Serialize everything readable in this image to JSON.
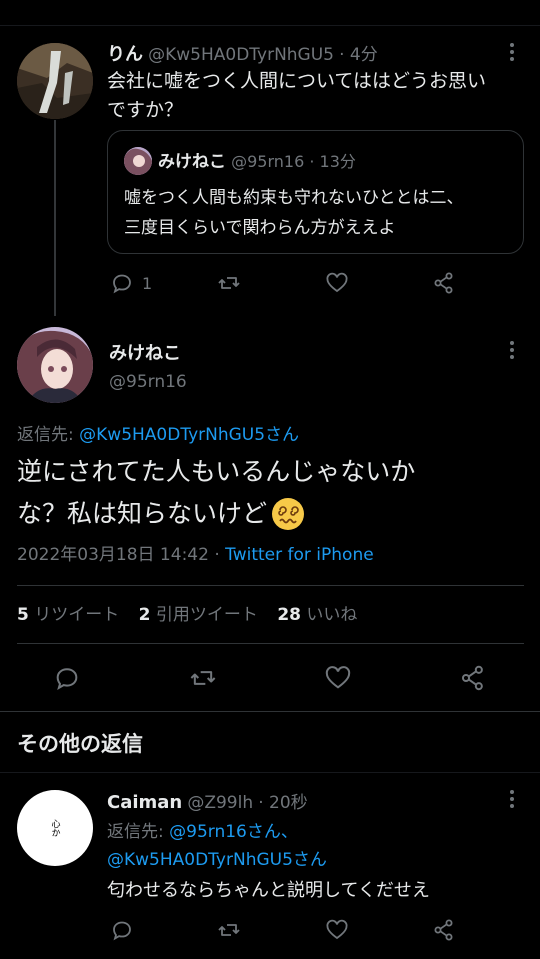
{
  "reply1": {
    "name": "りん",
    "handle": "@Kw5HA0DTyrNhGU5",
    "time": "· 4分",
    "text_line1": "会社に嘘をつく人間についてははどうお思い",
    "text_line2": "ですか？",
    "reply_count": "1"
  },
  "quoted": {
    "name": "みけねこ",
    "handle": "@95rn16",
    "time": "· 13分",
    "text_line1": "嘘をつく人間も約束も守れないひととは二、",
    "text_line2": "三度目くらいで関わらん方がええよ"
  },
  "main": {
    "name": "みけねこ",
    "handle": "@95rn16",
    "reply_to_label": "返信先: ",
    "reply_to_handle": "@Kw5HA0DTyrNhGU5さん",
    "text_line1": "逆にされてた人もいるんじゃないか",
    "text_line2": "な？私は知らないけど",
    "date": "2022年03月18日 14:42 · ",
    "source": "Twitter for iPhone",
    "stats": {
      "retweets_count": "5",
      "retweets_label": "リツイート",
      "quotes_count": "2",
      "quotes_label": "引用ツイート",
      "likes_count": "28",
      "likes_label": "いいね"
    }
  },
  "section_title": "その他の返信",
  "reply2": {
    "name": "Caiman",
    "handle": "@Z99lh",
    "time": "· 20秒",
    "reply_to_label": "返信先: ",
    "reply_to_handle1": "@95rn16さん、",
    "reply_to_handle2": "@Kw5HA0DTyrNhGU5さん",
    "text": "匂わせるならちゃんと説明してくだせえ",
    "avatar_text": "心か"
  },
  "colors": {
    "background": "#000000",
    "text": "#e7e9ea",
    "muted": "#71767b",
    "link": "#1d9bf0",
    "border": "#2f3336"
  }
}
